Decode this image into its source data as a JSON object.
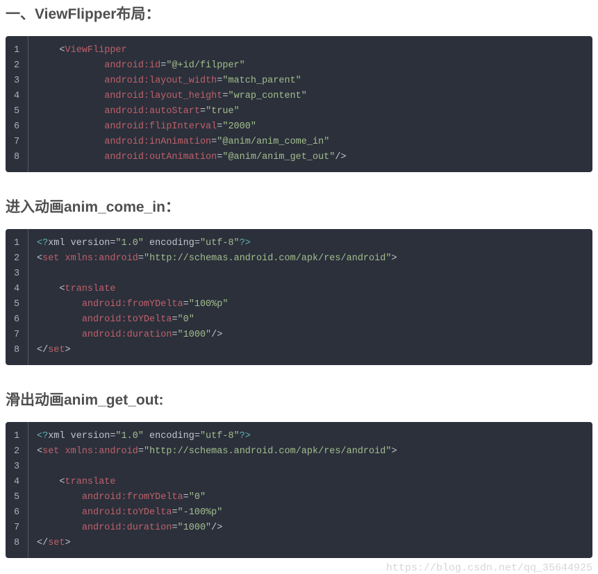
{
  "headings": {
    "h1": "一、ViewFlipper布局：",
    "h2": "进入动画anim_come_in：",
    "h3": "滑出动画anim_get_out:"
  },
  "watermark": "https://blog.csdn.net/qq_35644925",
  "blocks": {
    "block1": {
      "lines": [
        "1",
        "2",
        "3",
        "4",
        "5",
        "6",
        "7",
        "8"
      ],
      "code": [
        [
          {
            "t": "    <",
            "c": "punc"
          },
          {
            "t": "ViewFlipper",
            "c": "tag"
          }
        ],
        [
          {
            "t": "            ",
            "c": ""
          },
          {
            "t": "android:id",
            "c": "attr"
          },
          {
            "t": "=",
            "c": "punc"
          },
          {
            "t": "\"@+id/filpper\"",
            "c": "str"
          }
        ],
        [
          {
            "t": "            ",
            "c": ""
          },
          {
            "t": "android:layout_width",
            "c": "attr"
          },
          {
            "t": "=",
            "c": "punc"
          },
          {
            "t": "\"match_parent\"",
            "c": "str"
          }
        ],
        [
          {
            "t": "            ",
            "c": ""
          },
          {
            "t": "android:layout_height",
            "c": "attr"
          },
          {
            "t": "=",
            "c": "punc"
          },
          {
            "t": "\"wrap_content\"",
            "c": "str"
          }
        ],
        [
          {
            "t": "            ",
            "c": ""
          },
          {
            "t": "android:autoStart",
            "c": "attr"
          },
          {
            "t": "=",
            "c": "punc"
          },
          {
            "t": "\"true\"",
            "c": "str"
          }
        ],
        [
          {
            "t": "            ",
            "c": ""
          },
          {
            "t": "android:flipInterval",
            "c": "attr"
          },
          {
            "t": "=",
            "c": "punc"
          },
          {
            "t": "\"2000\"",
            "c": "str"
          }
        ],
        [
          {
            "t": "            ",
            "c": ""
          },
          {
            "t": "android:inAnimation",
            "c": "attr"
          },
          {
            "t": "=",
            "c": "punc"
          },
          {
            "t": "\"@anim/anim_come_in\"",
            "c": "str"
          }
        ],
        [
          {
            "t": "            ",
            "c": ""
          },
          {
            "t": "android:outAnimation",
            "c": "attr"
          },
          {
            "t": "=",
            "c": "punc"
          },
          {
            "t": "\"@anim/anim_get_out\"",
            "c": "str"
          },
          {
            "t": "/>",
            "c": "punc"
          }
        ]
      ]
    },
    "block2": {
      "lines": [
        "1",
        "2",
        "3",
        "4",
        "5",
        "6",
        "7",
        "8"
      ],
      "code": [
        [
          {
            "t": "<?",
            "c": "xmlh"
          },
          {
            "t": "xml version=",
            "c": "punc"
          },
          {
            "t": "\"1.0\"",
            "c": "str"
          },
          {
            "t": " encoding=",
            "c": "punc"
          },
          {
            "t": "\"utf-8\"",
            "c": "str"
          },
          {
            "t": "?>",
            "c": "xmlh"
          }
        ],
        [
          {
            "t": "<",
            "c": "punc"
          },
          {
            "t": "set",
            "c": "tag"
          },
          {
            "t": " ",
            "c": ""
          },
          {
            "t": "xmlns:android",
            "c": "attr"
          },
          {
            "t": "=",
            "c": "punc"
          },
          {
            "t": "\"http://schemas.android.com/apk/res/android\"",
            "c": "str"
          },
          {
            "t": ">",
            "c": "punc"
          }
        ],
        [
          {
            "t": " ",
            "c": ""
          }
        ],
        [
          {
            "t": "    <",
            "c": "punc"
          },
          {
            "t": "translate",
            "c": "tag"
          }
        ],
        [
          {
            "t": "        ",
            "c": ""
          },
          {
            "t": "android:fromYDelta",
            "c": "attr"
          },
          {
            "t": "=",
            "c": "punc"
          },
          {
            "t": "\"100%p\"",
            "c": "str"
          }
        ],
        [
          {
            "t": "        ",
            "c": ""
          },
          {
            "t": "android:toYDelta",
            "c": "attr"
          },
          {
            "t": "=",
            "c": "punc"
          },
          {
            "t": "\"0\"",
            "c": "str"
          }
        ],
        [
          {
            "t": "        ",
            "c": ""
          },
          {
            "t": "android:duration",
            "c": "attr"
          },
          {
            "t": "=",
            "c": "punc"
          },
          {
            "t": "\"1000\"",
            "c": "str"
          },
          {
            "t": "/>",
            "c": "punc"
          }
        ],
        [
          {
            "t": "</",
            "c": "punc"
          },
          {
            "t": "set",
            "c": "tag"
          },
          {
            "t": ">",
            "c": "punc"
          }
        ]
      ]
    },
    "block3": {
      "lines": [
        "1",
        "2",
        "3",
        "4",
        "5",
        "6",
        "7",
        "8"
      ],
      "code": [
        [
          {
            "t": "<?",
            "c": "xmlh"
          },
          {
            "t": "xml version=",
            "c": "punc"
          },
          {
            "t": "\"1.0\"",
            "c": "str"
          },
          {
            "t": " encoding=",
            "c": "punc"
          },
          {
            "t": "\"utf-8\"",
            "c": "str"
          },
          {
            "t": "?>",
            "c": "xmlh"
          }
        ],
        [
          {
            "t": "<",
            "c": "punc"
          },
          {
            "t": "set",
            "c": "tag"
          },
          {
            "t": " ",
            "c": ""
          },
          {
            "t": "xmlns:android",
            "c": "attr"
          },
          {
            "t": "=",
            "c": "punc"
          },
          {
            "t": "\"http://schemas.android.com/apk/res/android\"",
            "c": "str"
          },
          {
            "t": ">",
            "c": "punc"
          }
        ],
        [
          {
            "t": " ",
            "c": ""
          }
        ],
        [
          {
            "t": "    <",
            "c": "punc"
          },
          {
            "t": "translate",
            "c": "tag"
          }
        ],
        [
          {
            "t": "        ",
            "c": ""
          },
          {
            "t": "android:fromYDelta",
            "c": "attr"
          },
          {
            "t": "=",
            "c": "punc"
          },
          {
            "t": "\"0\"",
            "c": "str"
          }
        ],
        [
          {
            "t": "        ",
            "c": ""
          },
          {
            "t": "android:toYDelta",
            "c": "attr"
          },
          {
            "t": "=",
            "c": "punc"
          },
          {
            "t": "\"-100%p\"",
            "c": "str"
          }
        ],
        [
          {
            "t": "        ",
            "c": ""
          },
          {
            "t": "android:duration",
            "c": "attr"
          },
          {
            "t": "=",
            "c": "punc"
          },
          {
            "t": "\"1000\"",
            "c": "str"
          },
          {
            "t": "/>",
            "c": "punc"
          }
        ],
        [
          {
            "t": "</",
            "c": "punc"
          },
          {
            "t": "set",
            "c": "tag"
          },
          {
            "t": ">",
            "c": "punc"
          }
        ]
      ]
    }
  }
}
